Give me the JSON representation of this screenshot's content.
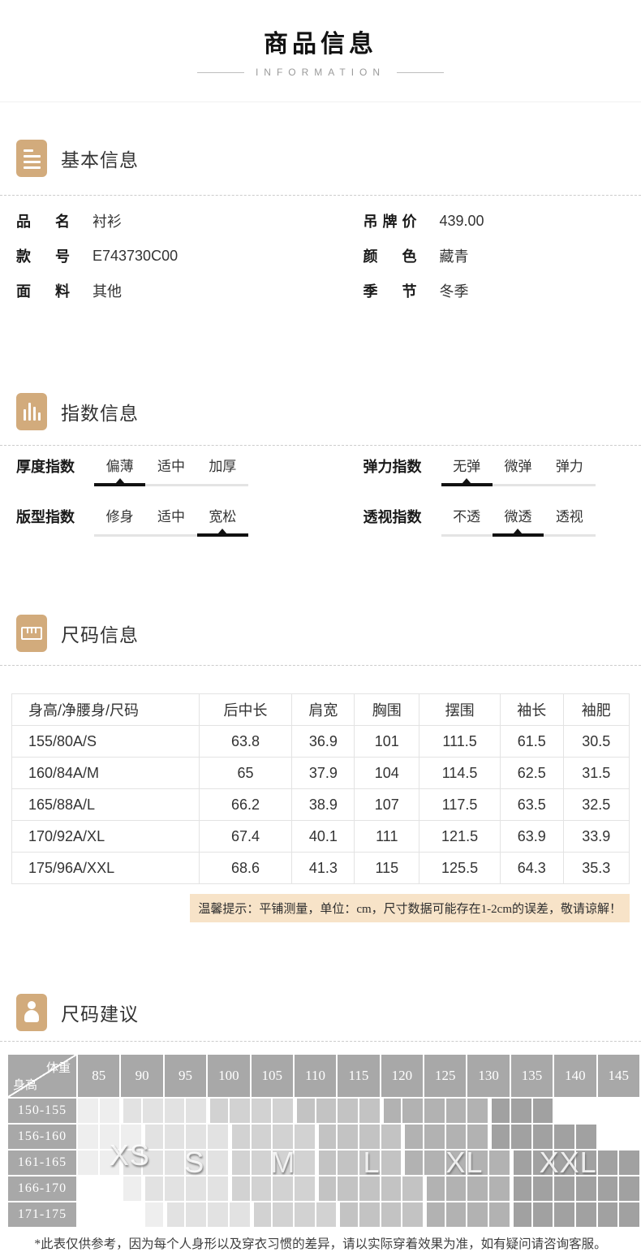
{
  "page": {
    "title": "商品信息",
    "subtitle": "INFORMATION"
  },
  "sections": {
    "basic": {
      "title": "基本信息"
    },
    "index": {
      "title": "指数信息"
    },
    "size": {
      "title": "尺码信息"
    },
    "suggest": {
      "title": "尺码建议"
    }
  },
  "basic_fields": {
    "left": [
      {
        "label": "品名",
        "value": "衬衫"
      },
      {
        "label": "款号",
        "value": "E743730C00"
      },
      {
        "label": "面料",
        "value": "其他"
      }
    ],
    "right": [
      {
        "label": "吊牌价",
        "value": "439.00"
      },
      {
        "label": "颜色",
        "value": "藏青"
      },
      {
        "label": "季节",
        "value": "冬季"
      }
    ]
  },
  "indices": [
    {
      "label": "厚度指数",
      "options": [
        "偏薄",
        "适中",
        "加厚"
      ],
      "selected": 0
    },
    {
      "label": "弹力指数",
      "options": [
        "无弹",
        "微弹",
        "弹力"
      ],
      "selected": 0
    },
    {
      "label": "版型指数",
      "options": [
        "修身",
        "适中",
        "宽松"
      ],
      "selected": 2
    },
    {
      "label": "透视指数",
      "options": [
        "不透",
        "微透",
        "透视"
      ],
      "selected": 1
    }
  ],
  "size_table": {
    "headers": [
      "身高/净腰身/尺码",
      "后中长",
      "肩宽",
      "胸围",
      "摆围",
      "袖长",
      "袖肥"
    ],
    "rows": [
      [
        "155/80A/S",
        "63.8",
        "36.9",
        "101",
        "111.5",
        "61.5",
        "30.5"
      ],
      [
        "160/84A/M",
        "65",
        "37.9",
        "104",
        "114.5",
        "62.5",
        "31.5"
      ],
      [
        "165/88A/L",
        "66.2",
        "38.9",
        "107",
        "117.5",
        "63.5",
        "32.5"
      ],
      [
        "170/92A/XL",
        "67.4",
        "40.1",
        "111",
        "121.5",
        "63.9",
        "33.9"
      ],
      [
        "175/96A/XXL",
        "68.6",
        "41.3",
        "115",
        "125.5",
        "64.3",
        "35.3"
      ]
    ],
    "note": "温馨提示：平铺测量，单位：cm，尺寸数据可能存在1-2cm的误差，敬请谅解！"
  },
  "size_chart": {
    "corner": {
      "top": "体重",
      "bottom": "身高"
    },
    "weights": [
      "85",
      "90",
      "95",
      "100",
      "105",
      "110",
      "115",
      "120",
      "125",
      "130",
      "135",
      "140",
      "145"
    ],
    "heights": [
      "150-155",
      "156-160",
      "161-165",
      "166-170",
      "171-175"
    ],
    "header_bg": "#a8a8a8",
    "zones": [
      {
        "label": "XS",
        "color": "#eeeeee",
        "rows": [
          [
            1,
            2
          ],
          [
            1,
            3
          ],
          [
            1,
            2
          ],
          [
            3,
            3
          ],
          [
            4,
            4
          ]
        ]
      },
      {
        "label": "S",
        "color": "#e2e2e2",
        "rows": [
          [
            3,
            6
          ],
          [
            4,
            7
          ],
          [
            3,
            7
          ],
          [
            4,
            7
          ],
          [
            5,
            8
          ]
        ]
      },
      {
        "label": "M",
        "color": "#d2d2d2",
        "rows": [
          [
            7,
            10
          ],
          [
            8,
            11
          ],
          [
            8,
            11
          ],
          [
            8,
            11
          ],
          [
            9,
            12
          ]
        ]
      },
      {
        "label": "L",
        "color": "#c3c3c3",
        "rows": [
          [
            11,
            14
          ],
          [
            12,
            15
          ],
          [
            12,
            15
          ],
          [
            12,
            16
          ],
          [
            13,
            16
          ]
        ]
      },
      {
        "label": "XL",
        "color": "#b2b2b2",
        "rows": [
          [
            15,
            19
          ],
          [
            16,
            19
          ],
          [
            16,
            20
          ],
          [
            17,
            20
          ],
          [
            17,
            20
          ]
        ]
      },
      {
        "label": "XXL",
        "color": "#a1a1a1",
        "rows": [
          [
            20,
            22
          ],
          [
            20,
            24
          ],
          [
            21,
            26
          ],
          [
            21,
            26
          ],
          [
            21,
            26
          ]
        ]
      }
    ],
    "footnote": "*此表仅供参考，因为每个人身形以及穿衣习惯的差异，请以实际穿着效果为准，如有疑问请咨询客服。"
  },
  "colors": {
    "accent_tan": "#d2ab7c",
    "note_bg": "#f7e3c8",
    "selected_bar": "#111111"
  }
}
